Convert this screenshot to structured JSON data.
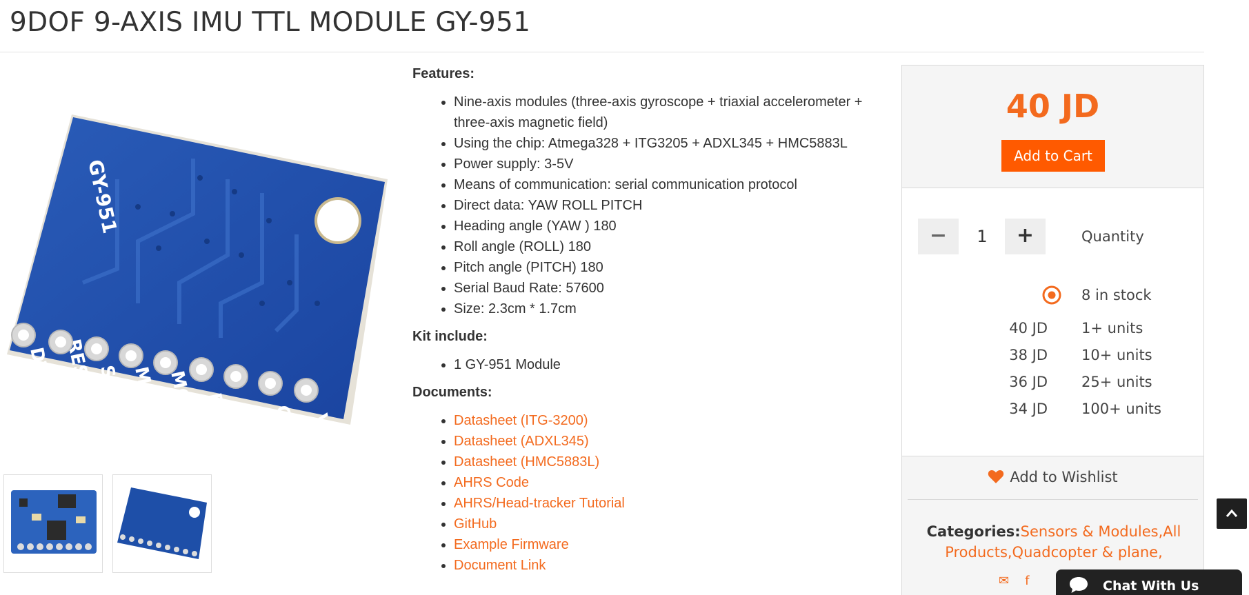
{
  "product": {
    "title": "9DOF 9-AXIS IMU TTL MODULE GY-951"
  },
  "gallery": {
    "main_image_alt": "GY-951 board back view",
    "thumbnails": [
      "GY-951 front",
      "GY-951 back"
    ],
    "board_labels": {
      "model": "GY-951",
      "pins": [
        "DTR",
        "RESET",
        "SCK",
        "MISO",
        "MOSI",
        "RX",
        "TX",
        "GND",
        "VIN"
      ]
    }
  },
  "description": {
    "features_heading": "Features:",
    "features": [
      "Nine-axis modules (three-axis gyroscope + triaxial accelerometer + three-axis magnetic field)",
      "Using the chip: Atmega328 + ITG3205 + ADXL345 + HMC5883L",
      "Power supply: 3-5V",
      "Means of communication: serial communication protocol",
      "Direct data: YAW ROLL PITCH",
      "Heading angle (YAW ) 180",
      "Roll angle (ROLL) 180",
      "Pitch angle (PITCH) 180",
      "Serial Baud Rate: 57600",
      "Size: 2.3cm * 1.7cm"
    ],
    "kit_heading": "Kit include:",
    "kit": [
      "1 GY-951 Module"
    ],
    "documents_heading": "Documents:",
    "documents": [
      "Datasheet (ITG-3200)",
      "Datasheet (ADXL345)",
      "Datasheet (HMC5883L)",
      "AHRS Code",
      "AHRS/Head-tracker Tutorial",
      "GitHub",
      "Example Firmware",
      "Document Link"
    ]
  },
  "sidebar": {
    "price": "40 JD",
    "add_to_cart": "Add to Cart",
    "quantity_minus": "−",
    "quantity_plus": "+",
    "quantity_value": "1",
    "quantity_label": "Quantity",
    "stock_text": "8 in stock",
    "tiers": [
      {
        "price": "40 JD",
        "units": "1+ units"
      },
      {
        "price": "38 JD",
        "units": "10+ units"
      },
      {
        "price": "36 JD",
        "units": "25+ units"
      },
      {
        "price": "34 JD",
        "units": "100+ units"
      }
    ],
    "wishlist": "Add to Wishlist",
    "categories_label": "Categories:",
    "categories_text": "Sensors & Modules,All Products,Quadcopter & plane,",
    "share_icons": [
      "envelope-icon",
      "facebook-icon"
    ]
  },
  "chat": {
    "label": "Chat With Us"
  },
  "colors": {
    "accent": "#f36a1e",
    "button": "#ff5a00",
    "board_blue": "#1e4fa8"
  }
}
